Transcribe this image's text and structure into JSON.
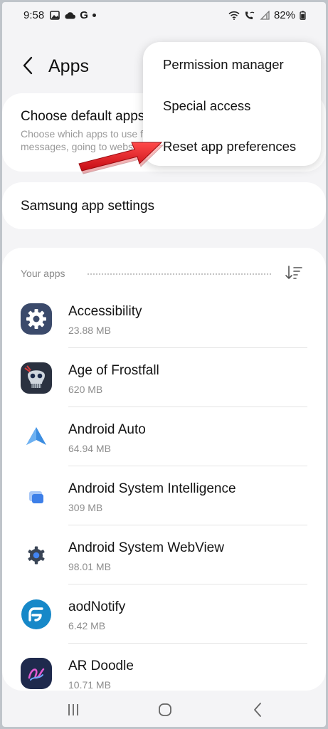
{
  "status_bar": {
    "time": "9:58",
    "battery": "82%",
    "left_icons": [
      "gallery-icon",
      "cloud-icon",
      "google-g-icon",
      "dot-icon"
    ],
    "right_icons": [
      "wifi-icon",
      "wifi-calling-icon",
      "signal-icon",
      "battery-icon"
    ]
  },
  "header": {
    "title": "Apps"
  },
  "default_apps": {
    "title": "Choose default apps",
    "subtitle_line1": "Choose which apps to use for calls,",
    "subtitle_line2": "messages, going to websites, and more."
  },
  "samsung": {
    "title": "Samsung app settings"
  },
  "your_apps": {
    "label": "Your apps",
    "items": [
      {
        "name": "Accessibility",
        "size": "23.88 MB",
        "icon": "accessibility-gear-icon"
      },
      {
        "name": "Age of Frostfall",
        "size": "620 MB",
        "icon": "age-of-frostfall-icon"
      },
      {
        "name": "Android Auto",
        "size": "64.94 MB",
        "icon": "android-auto-icon"
      },
      {
        "name": "Android System Intelligence",
        "size": "309 MB",
        "icon": "android-system-intelligence-icon"
      },
      {
        "name": "Android System WebView",
        "size": "98.01 MB",
        "icon": "webview-gear-icon"
      },
      {
        "name": "aodNotify",
        "size": "6.42 MB",
        "icon": "aodnotify-icon"
      },
      {
        "name": "AR Doodle",
        "size": "10.71 MB",
        "icon": "ar-doodle-icon"
      }
    ]
  },
  "menu": {
    "items": [
      "Permission manager",
      "Special access",
      "Reset app preferences"
    ]
  },
  "colors": {
    "background": "#f4f4f6",
    "card": "#ffffff",
    "arrow": "#e0141c",
    "accessibility_icon": "#3b4a6b",
    "aodnotify_icon": "#1788c8"
  }
}
